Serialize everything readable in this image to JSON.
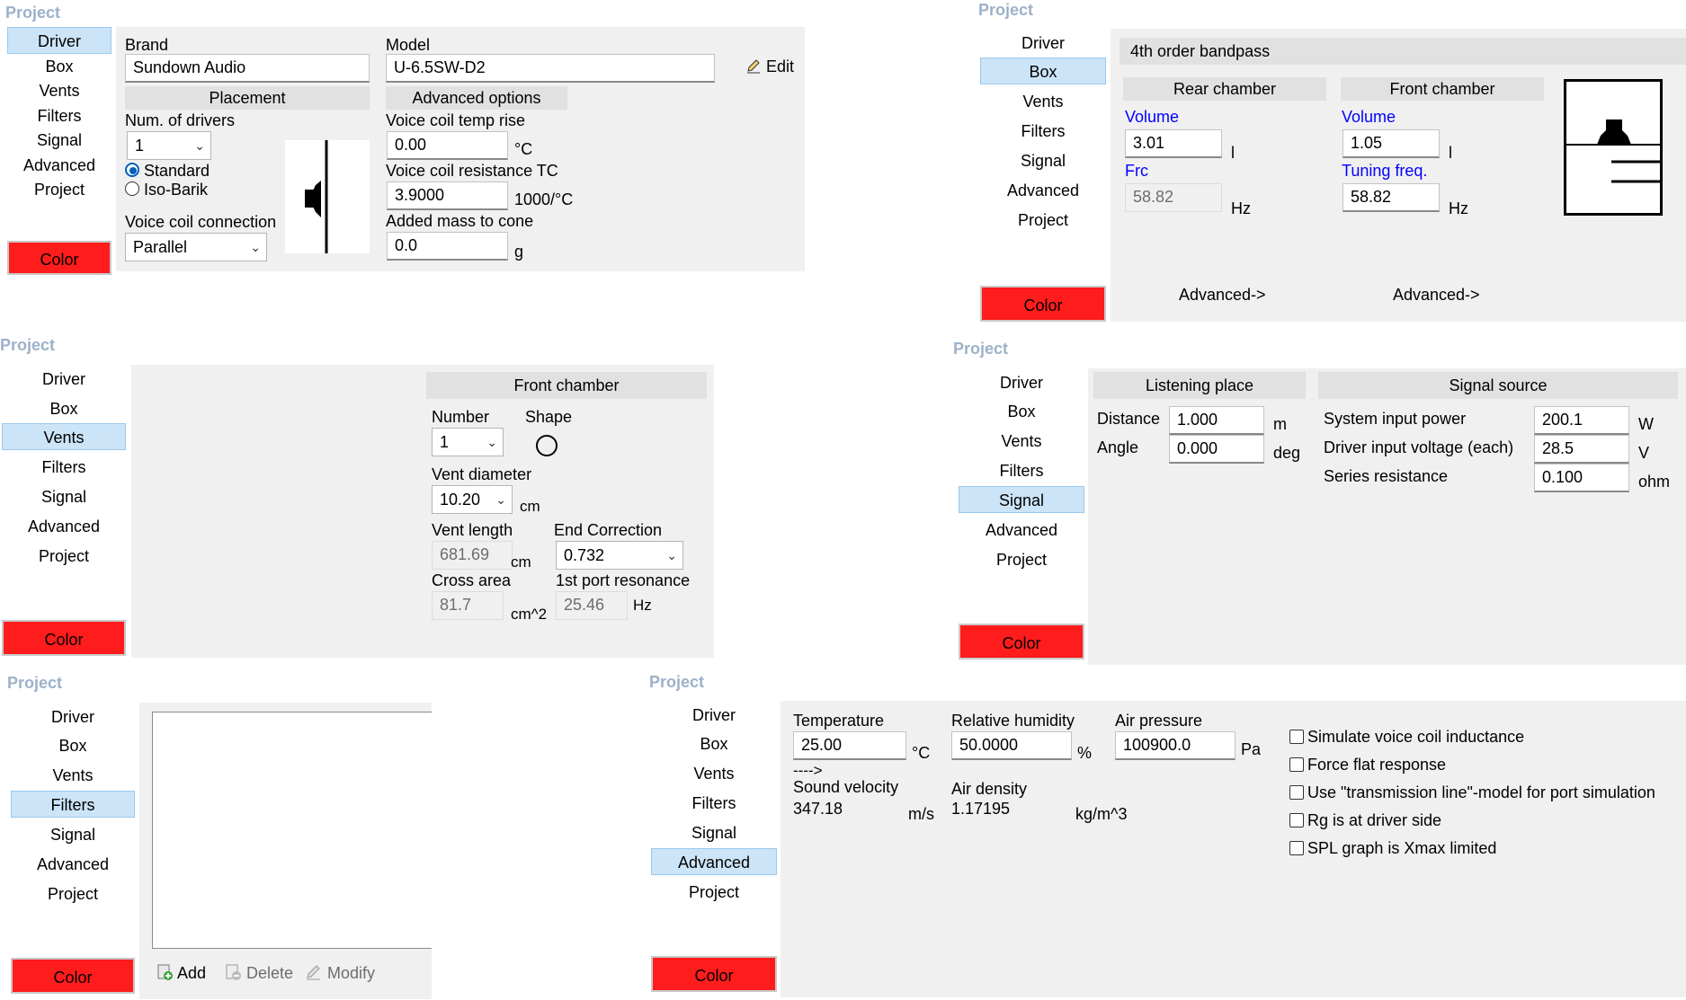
{
  "nav_items": [
    "Driver",
    "Box",
    "Vents",
    "Filters",
    "Signal",
    "Advanced",
    "Project"
  ],
  "section_title": "Project",
  "color_label": "Color",
  "driver": {
    "brand_label": "Brand",
    "brand_value": "Sundown Audio",
    "model_label": "Model",
    "model_value": "U-6.5SW-D2",
    "edit_label": "Edit",
    "placement_header": "Placement",
    "num_drivers_label": "Num. of drivers",
    "num_drivers_value": "1",
    "standard_label": "Standard",
    "isobarik_label": "Iso-Barik",
    "vc_connection_label": "Voice coil connection",
    "vc_connection_value": "Parallel",
    "advanced_header": "Advanced options",
    "vc_temp_label": "Voice coil temp rise",
    "vc_temp_value": "0.00",
    "vc_temp_unit": "°C",
    "vc_res_label": "Voice coil resistance TC",
    "vc_res_value": "3.9000",
    "vc_res_unit": "1000/°C",
    "added_mass_label": "Added mass to cone",
    "added_mass_value": "0.0",
    "added_mass_unit": "g"
  },
  "box": {
    "type_title": "4th order bandpass",
    "rear_header": "Rear chamber",
    "front_header": "Front chamber",
    "rear_volume_label": "Volume",
    "rear_volume_value": "3.01",
    "rear_volume_unit": "l",
    "frc_label": "Frc",
    "frc_value": "58.82",
    "frc_unit": "Hz",
    "front_volume_label": "Volume",
    "front_volume_value": "1.05",
    "front_volume_unit": "l",
    "tuning_label": "Tuning freq.",
    "tuning_value": "58.82",
    "tuning_unit": "Hz",
    "rear_advanced": "Advanced->",
    "front_advanced": "Advanced->"
  },
  "vents": {
    "header": "Front chamber",
    "number_label": "Number",
    "number_value": "1",
    "shape_label": "Shape",
    "diameter_label": "Vent diameter",
    "diameter_value": "10.20",
    "diameter_unit": "cm",
    "length_label": "Vent length",
    "length_value": "681.69",
    "length_unit": "cm",
    "end_corr_label": "End Correction",
    "end_corr_value": "0.732",
    "cross_label": "Cross area",
    "cross_value": "81.7",
    "cross_unit": "cm^2",
    "port_res_label": "1st port resonance",
    "port_res_value": "25.46",
    "port_res_unit": "Hz"
  },
  "signal": {
    "listening_header": "Listening place",
    "source_header": "Signal source",
    "distance_label": "Distance",
    "distance_value": "1.000",
    "distance_unit": "m",
    "angle_label": "Angle",
    "angle_value": "0.000",
    "angle_unit": "deg",
    "power_label": "System input power",
    "power_value": "200.1",
    "power_unit": "W",
    "voltage_label": "Driver input voltage (each)",
    "voltage_value": "28.5",
    "voltage_unit": "V",
    "series_label": "Series resistance",
    "series_value": "0.100",
    "series_unit": "ohm"
  },
  "filters": {
    "add_label": "Add",
    "delete_label": "Delete",
    "modify_label": "Modify"
  },
  "advanced": {
    "temp_label": "Temperature",
    "temp_value": "25.00",
    "temp_unit": "°C",
    "humidity_label": "Relative humidity",
    "humidity_value": "50.0000",
    "humidity_unit": "%",
    "pressure_label": "Air pressure",
    "pressure_value": "100900.0",
    "pressure_unit": "Pa",
    "arrow": "---->",
    "sound_label": "Sound velocity",
    "sound_value": "347.18",
    "sound_unit": "m/s",
    "density_label": "Air density",
    "density_value": "1.17195",
    "density_unit": "kg/m^3",
    "checks": [
      "Simulate voice coil inductance",
      "Force flat response",
      "Use \"transmission line\"-model for port simulation",
      "Rg is at driver side",
      "SPL graph is Xmax limited"
    ]
  },
  "colors": {
    "accent_red": "#ff1c1c",
    "nav_selected": "#cce4f7",
    "section_title": "#9db1c9",
    "link_blue": "#0000ff"
  }
}
